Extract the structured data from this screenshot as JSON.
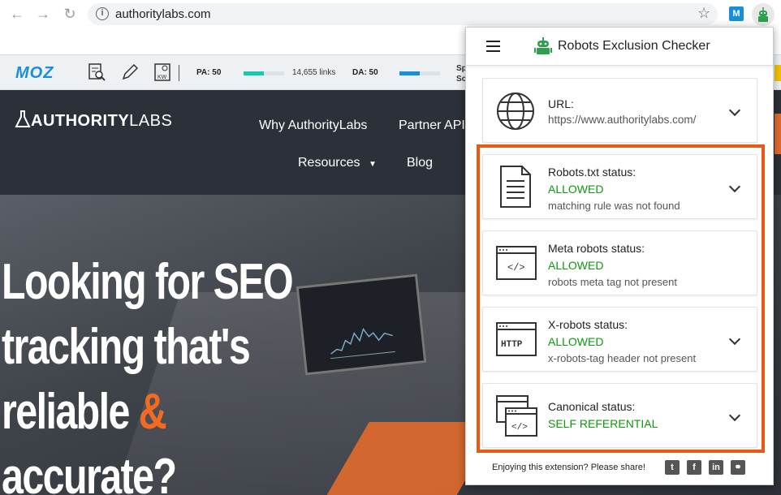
{
  "browser": {
    "url": "authoritylabs.com",
    "back_icon": "←",
    "forward_icon": "→",
    "reload_icon": "↻",
    "star_icon": "☆",
    "ext_m_label": "M"
  },
  "mozbar": {
    "logo": "MOZ",
    "pa_label": "PA: 50",
    "pa_value": 0.5,
    "links": "14,655 links",
    "da_label": "DA: 50",
    "da_value": 0.5,
    "extra_top": "Sp",
    "extra_bottom": "Sc"
  },
  "site": {
    "logo_bold": "AUTHORITY",
    "logo_light": "LABS",
    "nav": {
      "why": "Why AuthorityLabs",
      "partner": "Partner API",
      "resources": "Resources",
      "resources_caret": "▼",
      "blog": "Blog"
    },
    "hero": {
      "line1": "Looking for SEO",
      "line2": "tracking that's",
      "line3": "reliable ",
      "amp": "&",
      "line4": "accurate?"
    }
  },
  "popup": {
    "title": "Robots Exclusion Checker",
    "cards": [
      {
        "title": "URL:",
        "status": "",
        "sub": "https://www.authoritylabs.com/"
      },
      {
        "title": "Robots.txt status:",
        "status": "ALLOWED",
        "sub": "matching rule was not found"
      },
      {
        "title": "Meta robots status:",
        "status": "ALLOWED",
        "sub": "robots meta tag not present"
      },
      {
        "title": "X-robots status:",
        "status": "ALLOWED",
        "sub": "x-robots-tag header not present"
      },
      {
        "title": "Canonical status:",
        "status": "SELF REFERENTIAL",
        "sub": ""
      }
    ],
    "icon_labels": {
      "meta": "</>",
      "http": "HTTP",
      "canonical": "</>"
    },
    "footer_text": "Enjoying this extension? Please share!",
    "share": {
      "twitter": "t",
      "facebook": "f",
      "linkedin": "in",
      "link": "⚭"
    }
  },
  "colors": {
    "status_green": "#0c9a0c",
    "highlight_orange": "#e85a12",
    "accent_orange": "#f26b21",
    "moz_blue": "#1a8fd8"
  }
}
